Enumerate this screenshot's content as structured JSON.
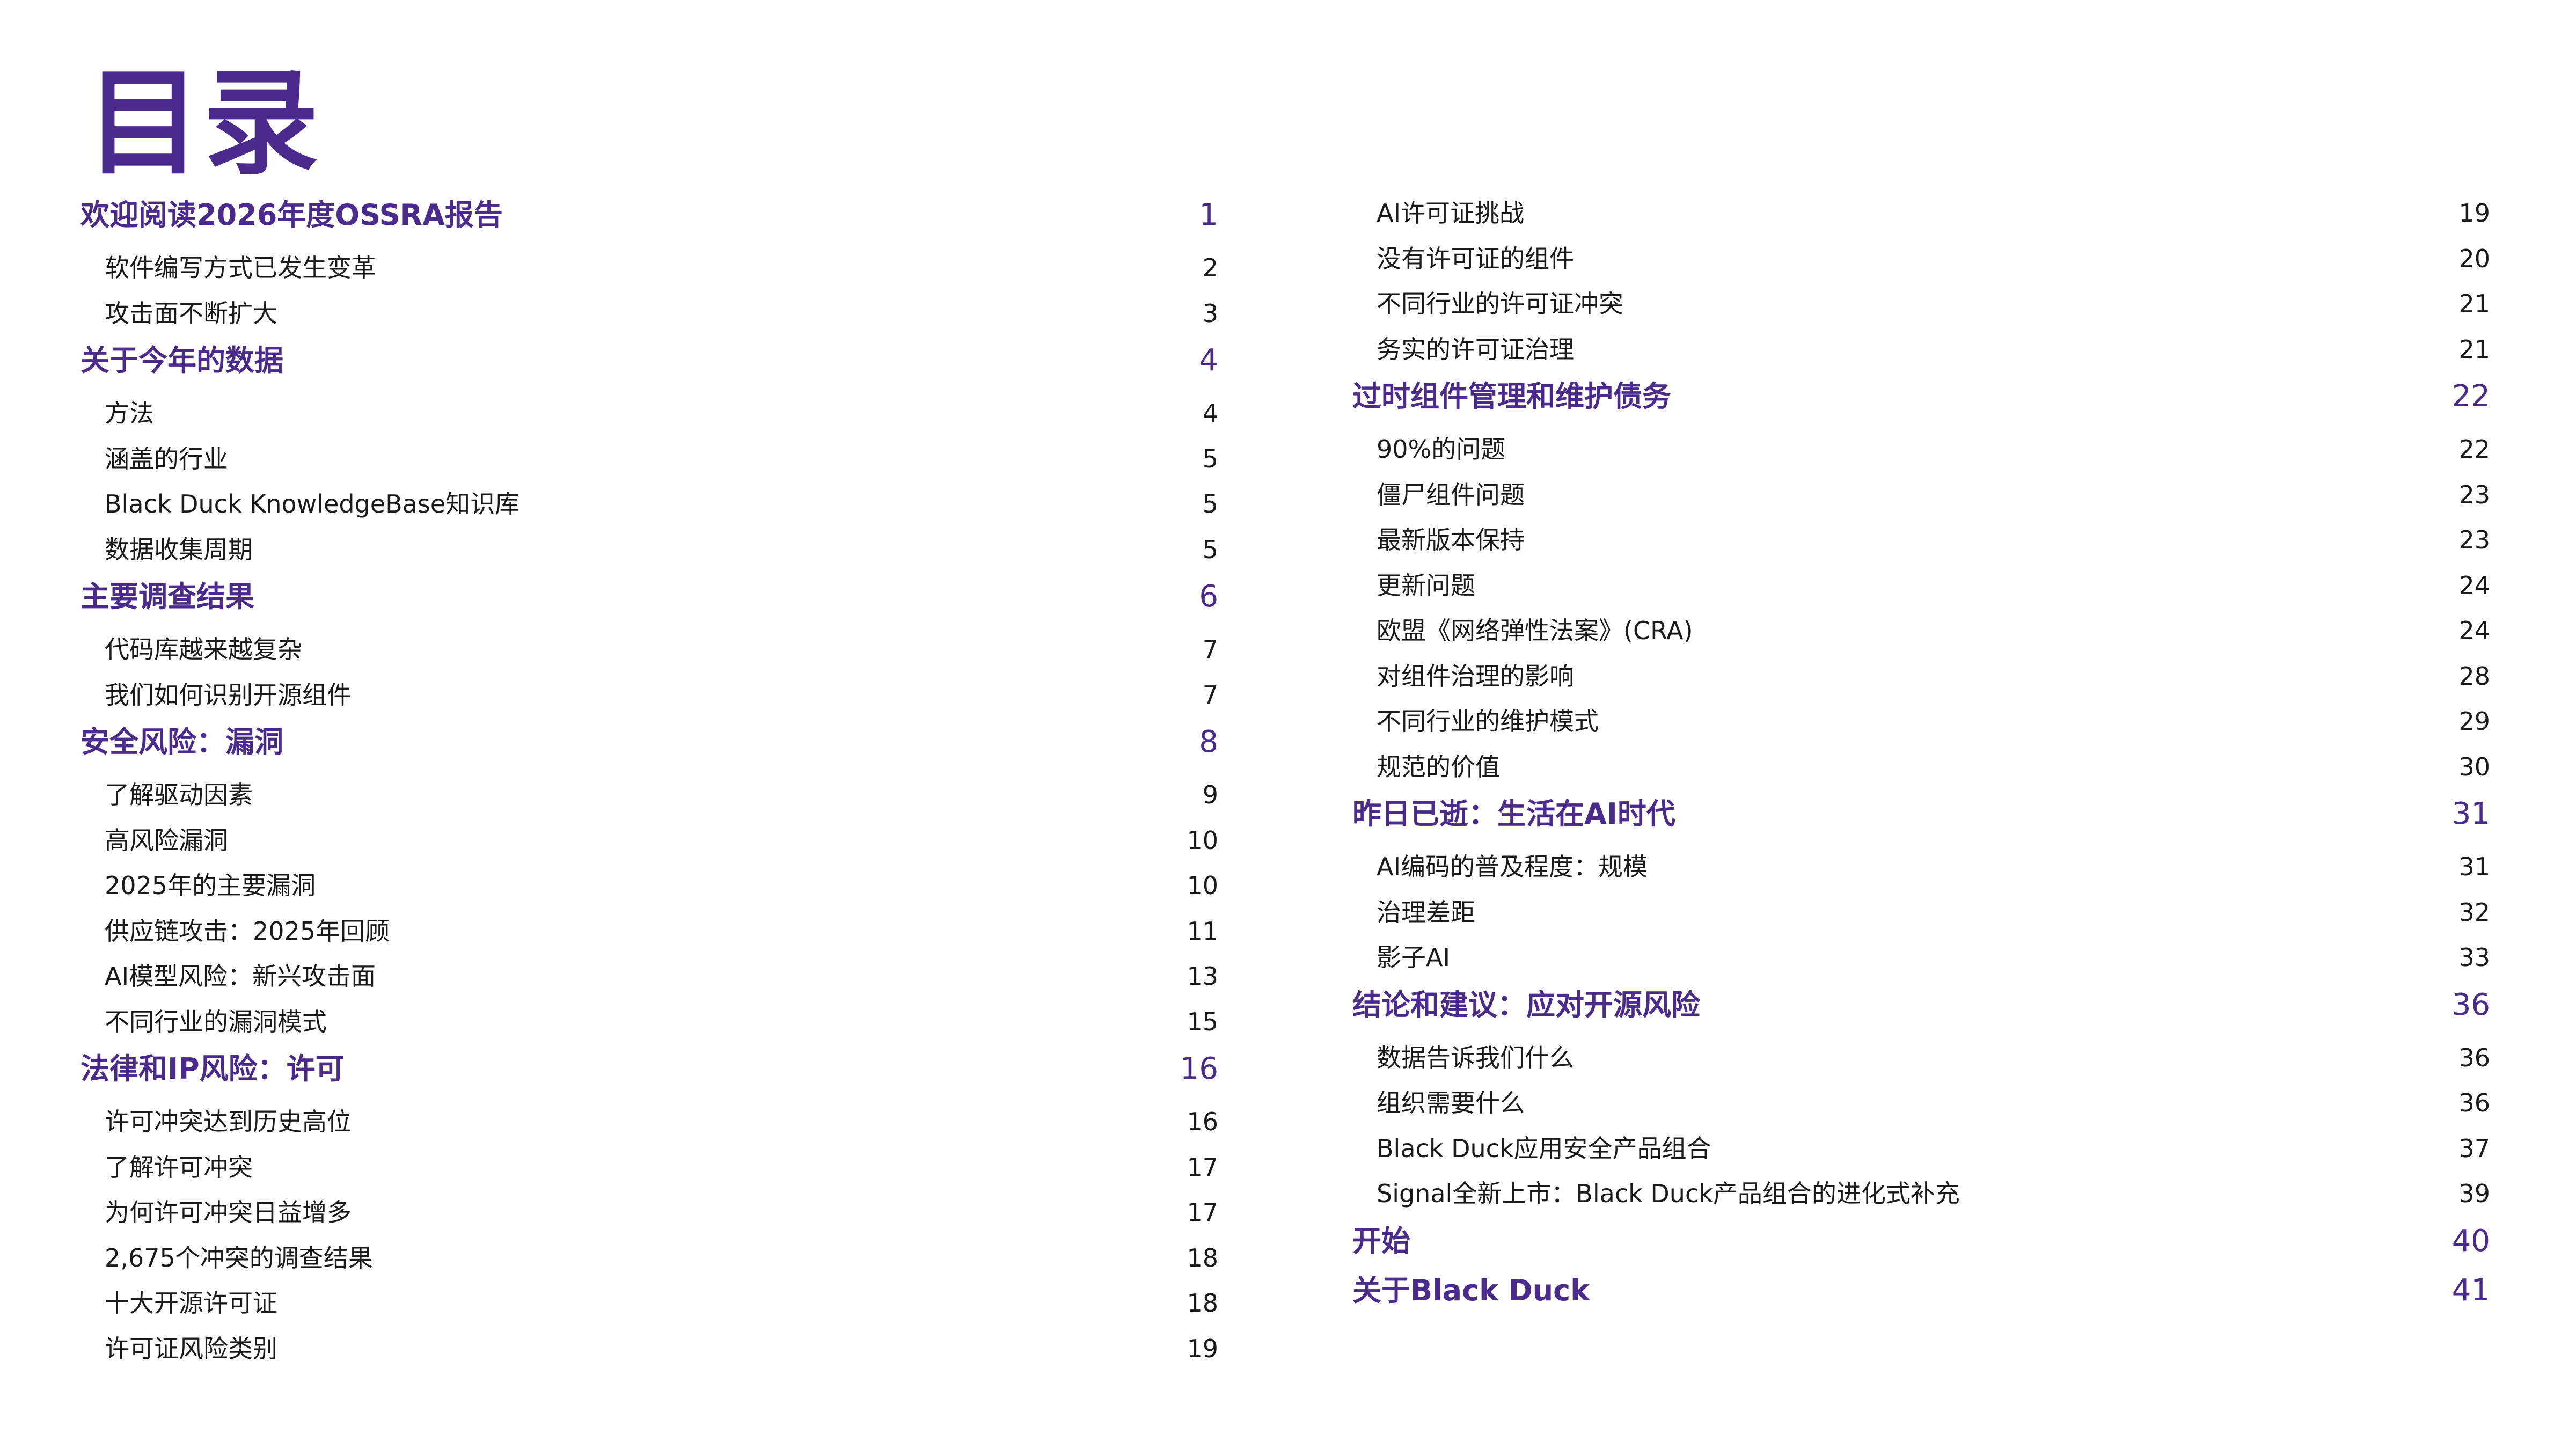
{
  "title": "目录",
  "colors": {
    "accent": "#4a2a8c",
    "text": "#1a1a1a",
    "background": "#ffffff"
  },
  "left_column": [
    {
      "type": "section",
      "label": "欢迎阅读2026年度OSSRA报告",
      "page": "1"
    },
    {
      "type": "sub",
      "label": "软件编写方式已发生变革",
      "page": "2"
    },
    {
      "type": "sub",
      "label": "攻击面不断扩大",
      "page": "3"
    },
    {
      "type": "section",
      "label": "关于今年的数据",
      "page": "4"
    },
    {
      "type": "sub",
      "label": "方法",
      "page": "4"
    },
    {
      "type": "sub",
      "label": "涵盖的行业",
      "page": "5"
    },
    {
      "type": "sub",
      "label": "Black Duck KnowledgeBase知识库",
      "page": "5"
    },
    {
      "type": "sub",
      "label": "数据收集周期",
      "page": "5"
    },
    {
      "type": "section",
      "label": "主要调查结果",
      "page": "6"
    },
    {
      "type": "sub",
      "label": "代码库越来越复杂",
      "page": "7"
    },
    {
      "type": "sub",
      "label": "我们如何识别开源组件",
      "page": "7"
    },
    {
      "type": "section",
      "label": "安全风险：漏洞",
      "page": "8"
    },
    {
      "type": "sub",
      "label": "了解驱动因素",
      "page": "9"
    },
    {
      "type": "sub",
      "label": "高风险漏洞",
      "page": "10"
    },
    {
      "type": "sub",
      "label": "2025年的主要漏洞",
      "page": "10"
    },
    {
      "type": "sub",
      "label": "供应链攻击：2025年回顾",
      "page": "11"
    },
    {
      "type": "sub",
      "label": "AI模型风险：新兴攻击面",
      "page": "13"
    },
    {
      "type": "sub",
      "label": "不同行业的漏洞模式",
      "page": "15"
    },
    {
      "type": "section",
      "label": "法律和IP风险：许可",
      "page": "16"
    },
    {
      "type": "sub",
      "label": "许可冲突达到历史高位",
      "page": "16"
    },
    {
      "type": "sub",
      "label": "了解许可冲突",
      "page": "17"
    },
    {
      "type": "sub",
      "label": "为何许可冲突日益增多",
      "page": "17"
    },
    {
      "type": "sub",
      "label": "2,675个冲突的调查结果",
      "page": "18"
    },
    {
      "type": "sub",
      "label": "十大开源许可证",
      "page": "18"
    },
    {
      "type": "sub",
      "label": "许可证风险类别",
      "page": "19"
    }
  ],
  "right_column": [
    {
      "type": "sub",
      "label": "AI许可证挑战",
      "page": "19"
    },
    {
      "type": "sub",
      "label": "没有许可证的组件",
      "page": "20"
    },
    {
      "type": "sub",
      "label": "不同行业的许可证冲突",
      "page": "21"
    },
    {
      "type": "sub",
      "label": "务实的许可证治理",
      "page": "21"
    },
    {
      "type": "section",
      "label": "过时组件管理和维护债务",
      "page": "22"
    },
    {
      "type": "sub",
      "label": "90%的问题",
      "page": "22"
    },
    {
      "type": "sub",
      "label": "僵尸组件问题",
      "page": "23"
    },
    {
      "type": "sub",
      "label": "最新版本保持",
      "page": "23"
    },
    {
      "type": "sub",
      "label": "更新问题",
      "page": "24"
    },
    {
      "type": "sub",
      "label": "欧盟《网络弹性法案》(CRA)",
      "page": "24"
    },
    {
      "type": "sub",
      "label": "对组件治理的影响",
      "page": "28"
    },
    {
      "type": "sub",
      "label": "不同行业的维护模式",
      "page": "29"
    },
    {
      "type": "sub",
      "label": "规范的价值",
      "page": "30"
    },
    {
      "type": "section",
      "label": "昨日已逝：生活在AI时代",
      "page": "31"
    },
    {
      "type": "sub",
      "label": "AI编码的普及程度：规模",
      "page": "31"
    },
    {
      "type": "sub",
      "label": "治理差距",
      "page": "32"
    },
    {
      "type": "sub",
      "label": "影子AI",
      "page": "33"
    },
    {
      "type": "section",
      "label": "结论和建议：应对开源风险",
      "page": "36"
    },
    {
      "type": "sub",
      "label": "数据告诉我们什么",
      "page": "36"
    },
    {
      "type": "sub",
      "label": "组织需要什么",
      "page": "36"
    },
    {
      "type": "sub",
      "label": "Black Duck应用安全产品组合",
      "page": "37"
    },
    {
      "type": "sub",
      "label": "Signal全新上市：Black Duck产品组合的进化式补充",
      "page": "39"
    },
    {
      "type": "section",
      "label": "开始",
      "page": "40"
    },
    {
      "type": "section",
      "label": "关于Black Duck",
      "page": "41"
    }
  ]
}
